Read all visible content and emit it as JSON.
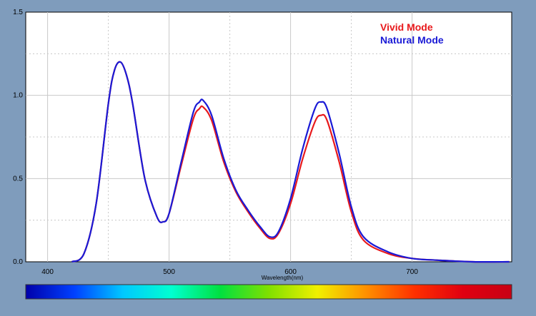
{
  "chart_data": {
    "type": "line",
    "xlabel": "Wavelength(nm)",
    "ylabel": "",
    "xlim": [
      382,
      782
    ],
    "ylim": [
      0,
      1.5
    ],
    "x_ticks": [
      "400",
      "500",
      "600",
      "700"
    ],
    "y_ticks": [
      "0.0",
      "0.5",
      "1.0",
      "1.5"
    ],
    "grid": true,
    "legend_position": "top-right",
    "series": [
      {
        "name": "Vivid Mode",
        "color": "#e8191c",
        "x": [
          420,
          430,
          440,
          450,
          455,
          460,
          465,
          470,
          480,
          490,
          495,
          500,
          510,
          520,
          525,
          528,
          535,
          545,
          555,
          565,
          575,
          583,
          590,
          600,
          610,
          620,
          625,
          630,
          640,
          650,
          660,
          680,
          700,
          720,
          750,
          780
        ],
        "y": [
          0.0,
          0.05,
          0.35,
          0.95,
          1.15,
          1.2,
          1.12,
          0.95,
          0.5,
          0.27,
          0.24,
          0.29,
          0.58,
          0.86,
          0.92,
          0.93,
          0.85,
          0.6,
          0.42,
          0.3,
          0.2,
          0.14,
          0.17,
          0.35,
          0.62,
          0.84,
          0.88,
          0.85,
          0.6,
          0.3,
          0.13,
          0.05,
          0.02,
          0.01,
          0.0,
          0.0
        ]
      },
      {
        "name": "Natural Mode",
        "color": "#1a1ad6",
        "x": [
          420,
          430,
          440,
          450,
          455,
          460,
          465,
          470,
          480,
          490,
          495,
          500,
          510,
          520,
          525,
          528,
          535,
          545,
          555,
          565,
          575,
          583,
          590,
          600,
          610,
          620,
          625,
          630,
          640,
          650,
          660,
          680,
          700,
          720,
          750,
          780
        ],
        "y": [
          0.0,
          0.05,
          0.35,
          0.95,
          1.15,
          1.2,
          1.12,
          0.95,
          0.5,
          0.27,
          0.24,
          0.29,
          0.6,
          0.9,
          0.96,
          0.97,
          0.88,
          0.62,
          0.43,
          0.31,
          0.21,
          0.15,
          0.18,
          0.38,
          0.68,
          0.92,
          0.96,
          0.92,
          0.65,
          0.33,
          0.15,
          0.06,
          0.02,
          0.01,
          0.0,
          0.0
        ]
      }
    ]
  },
  "spectrum_bar": {
    "stops": [
      "#0000aa",
      "#0040ff",
      "#00c8ff",
      "#00ffd0",
      "#00e040",
      "#80e000",
      "#f0f000",
      "#ff9000",
      "#ff3000",
      "#e00010",
      "#c80014"
    ]
  }
}
